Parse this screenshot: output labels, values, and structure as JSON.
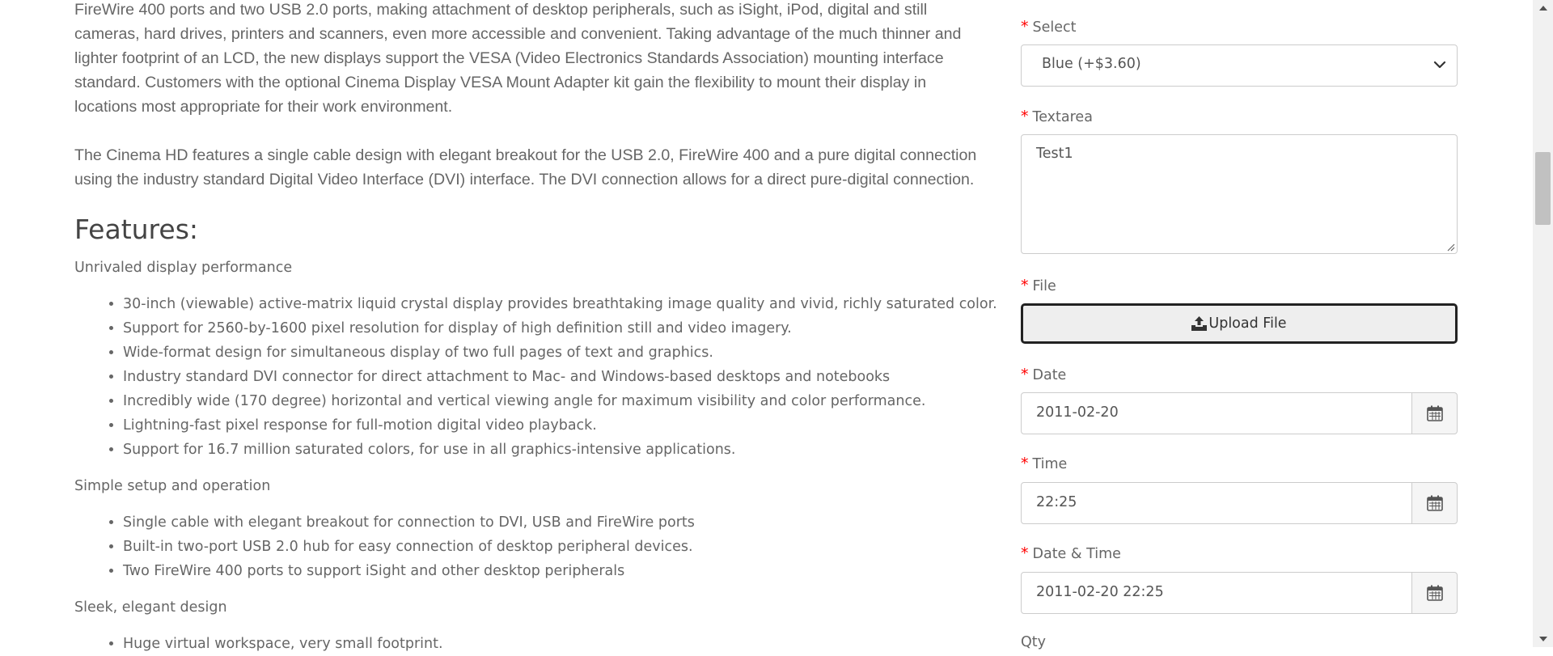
{
  "description": {
    "paragraph_1": "FireWire 400 ports and two USB 2.0 ports, making attachment of desktop peripherals, such as iSight, iPod, digital and still cameras, hard drives, printers and scanners, even more accessible and convenient. Taking advantage of the much thinner and lighter footprint of an LCD, the new displays support the VESA (Video Electronics Standards Association) mounting interface standard. Customers with the optional Cinema Display VESA Mount Adapter kit gain the flexibility to mount their display in locations most appropriate for their work environment.",
    "paragraph_2": "The Cinema HD features a single cable design with elegant breakout for the USB 2.0, FireWire 400 and a pure digital connection using the industry standard Digital Video Interface (DVI) interface. The DVI connection allows for a direct pure-digital connection.",
    "features_title": "Features:",
    "sections": [
      {
        "label": "Unrivaled display performance",
        "items": [
          "30-inch (viewable) active-matrix liquid crystal display provides breathtaking image quality and vivid, richly saturated color.",
          "Support for 2560-by-1600 pixel resolution for display of high definition still and video imagery.",
          "Wide-format design for simultaneous display of two full pages of text and graphics.",
          "Industry standard DVI connector for direct attachment to Mac- and Windows-based desktops and notebooks",
          "Incredibly wide (170 degree) horizontal and vertical viewing angle for maximum visibility and color performance.",
          "Lightning-fast pixel response for full-motion digital video playback.",
          "Support for 16.7 million saturated colors, for use in all graphics-intensive applications."
        ]
      },
      {
        "label": "Simple setup and operation",
        "items": [
          "Single cable with elegant breakout for connection to DVI, USB and FireWire ports",
          "Built-in two-port USB 2.0 hub for easy connection of desktop peripheral devices.",
          "Two FireWire 400 ports to support iSight and other desktop peripherals"
        ]
      },
      {
        "label": "Sleek, elegant design",
        "items": [
          "Huge virtual workspace, very small footprint."
        ]
      }
    ]
  },
  "options_form": {
    "required_marker": "*",
    "select": {
      "label": "Select",
      "value": "Blue (+$3.60)"
    },
    "textarea": {
      "label": "Textarea",
      "value": "Test1"
    },
    "file": {
      "label": "File",
      "button_label": "Upload File"
    },
    "date": {
      "label": "Date",
      "value": "2011-02-20"
    },
    "time": {
      "label": "Time",
      "value": "22:25"
    },
    "datetime": {
      "label": "Date & Time",
      "value": "2011-02-20 22:25"
    },
    "qty": {
      "label": "Qty"
    }
  },
  "colors": {
    "required": "#ff0000",
    "text": "#666666",
    "heading": "#444444",
    "border": "#cccccc"
  },
  "icons": {
    "select": "chevron-down-icon",
    "upload": "upload-icon",
    "date": "calendar-icon",
    "time": "calendar-icon",
    "datetime": "calendar-icon",
    "textarea_resize": "resize-grip-icon"
  }
}
